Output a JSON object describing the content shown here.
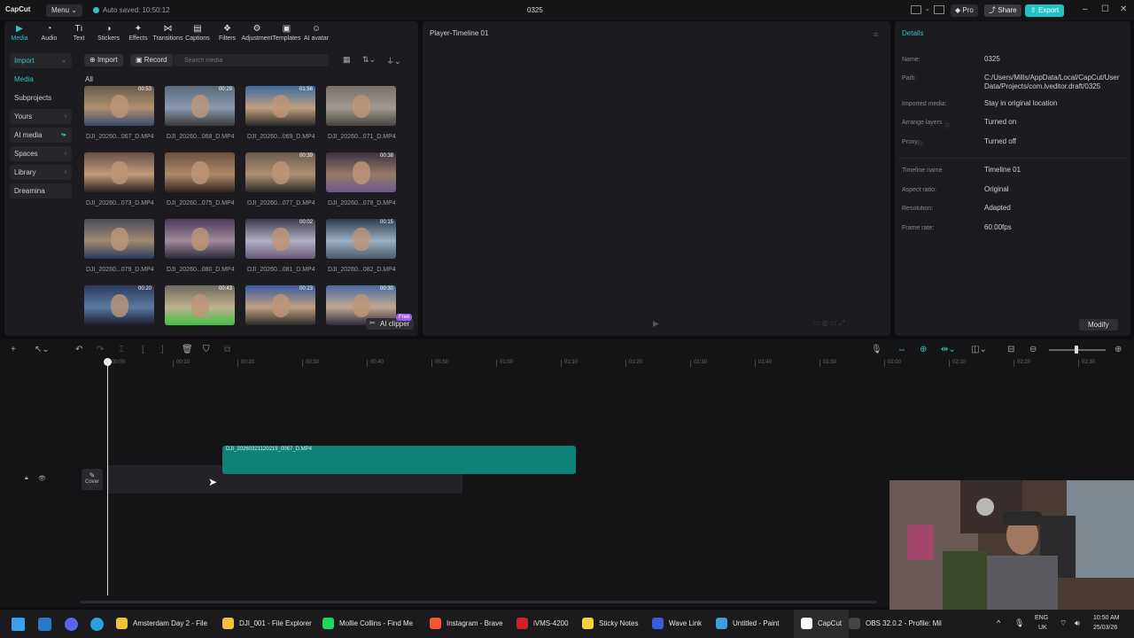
{
  "titlebar": {
    "logo": "CapCut",
    "menu_label": "Menu",
    "autosave": "Auto saved: 10:50:12",
    "project_name": "0325",
    "pro_label": "Pro",
    "share_label": "Share",
    "export_label": "Export"
  },
  "toolbar": {
    "tabs": [
      {
        "label": "Media",
        "icon": "media-icon"
      },
      {
        "label": "Audio",
        "icon": "audio-icon"
      },
      {
        "label": "Text",
        "icon": "text-icon"
      },
      {
        "label": "Stickers",
        "icon": "stickers-icon"
      },
      {
        "label": "Effects",
        "icon": "effects-icon"
      },
      {
        "label": "Transitions",
        "icon": "transitions-icon"
      },
      {
        "label": "Captions",
        "icon": "captions-icon"
      },
      {
        "label": "Filters",
        "icon": "filters-icon"
      },
      {
        "label": "Adjustment",
        "icon": "adjustment-icon"
      },
      {
        "label": "Templates",
        "icon": "templates-icon"
      },
      {
        "label": "AI avatar",
        "icon": "ai-avatar-icon"
      }
    ]
  },
  "sidebar": {
    "items": [
      {
        "label": "Import"
      },
      {
        "label": "Media"
      },
      {
        "label": "Subprojects"
      },
      {
        "label": "Yours"
      },
      {
        "label": "AI media"
      },
      {
        "label": "Spaces"
      },
      {
        "label": "Library"
      },
      {
        "label": "Dreamina"
      }
    ]
  },
  "media": {
    "import_label": "Import",
    "record_label": "Record",
    "search_placeholder": "Search media",
    "all_label": "All",
    "ai_clipper_label": "AI clipper",
    "free_badge": "Free",
    "items": [
      {
        "name": "DJI_20260...067_D.MP4",
        "duration": "00:53"
      },
      {
        "name": "DJI_20260...068_D.MP4",
        "duration": "00:29"
      },
      {
        "name": "DJI_20260...069_D.MP4",
        "duration": "01:56"
      },
      {
        "name": "DJI_20260...071_D.MP4",
        "duration": ""
      },
      {
        "name": "DJI_20260...073_D.MP4",
        "duration": ""
      },
      {
        "name": "DJI_20260...075_D.MP4",
        "duration": ""
      },
      {
        "name": "DJI_20260...077_D.MP4",
        "duration": "00:39"
      },
      {
        "name": "DJI_20260...078_D.MP4",
        "duration": "00:38"
      },
      {
        "name": "DJI_20260...079_D.MP4",
        "duration": ""
      },
      {
        "name": "DJI_20260...080_D.MP4",
        "duration": ""
      },
      {
        "name": "DJI_20260...081_D.MP4",
        "duration": "00:02"
      },
      {
        "name": "DJI_20260...082_D.MP4",
        "duration": "00:15"
      },
      {
        "name": "",
        "duration": "00:20"
      },
      {
        "name": "",
        "duration": "00:43"
      },
      {
        "name": "",
        "duration": "00:23"
      },
      {
        "name": "",
        "duration": "00:30"
      }
    ]
  },
  "player": {
    "title": "Player-Timeline 01"
  },
  "details": {
    "title": "Details",
    "rows": [
      {
        "label": "Name:",
        "value": "0325"
      },
      {
        "label": "Path:",
        "value": "C:/Users/Mills/AppData/Local/CapCut/User Data/Projects/com.lveditor.draft/0325"
      },
      {
        "label": "Imported media:",
        "value": "Stay in original location"
      },
      {
        "label": "Arrange layers",
        "value": "Turned on"
      },
      {
        "label": "Proxy:",
        "value": "Turned off"
      },
      {
        "label": "Timeline name",
        "value": "Timeline 01"
      },
      {
        "label": "Aspect ratio:",
        "value": "Original"
      },
      {
        "label": "Resolution:",
        "value": "Adapted"
      },
      {
        "label": "Frame rate:",
        "value": "60.00fps"
      }
    ],
    "modify_label": "Modify"
  },
  "timeline": {
    "ticks": [
      "00:00",
      "00:10",
      "00:20",
      "00:30",
      "00:40",
      "00:50",
      "01:00",
      "01:10",
      "01:20",
      "01:30",
      "01:40",
      "01:50",
      "02:00",
      "02:10",
      "02:20",
      "02:30"
    ],
    "clip_label": "DJI_20260321120219_0067_D.MP4",
    "cover_label": "Cover"
  },
  "taskbar": {
    "items": [
      {
        "label": "Amsterdam Day 2 - File",
        "color": "#f0c23b"
      },
      {
        "label": "DJI_001 - File Explorer",
        "color": "#f0c23b"
      },
      {
        "label": "Mollie Collins - Find Me",
        "color": "#1ed760"
      },
      {
        "label": "Instagram - Brave",
        "color": "#fb542b"
      },
      {
        "label": "iVMS-4200",
        "color": "#d0202a"
      },
      {
        "label": "Sticky Notes",
        "color": "#f5d13a"
      },
      {
        "label": "Wave Link",
        "color": "#3b5bdb"
      },
      {
        "label": "Untitled - Paint",
        "color": "#3ba0d9"
      },
      {
        "label": "CapCut",
        "color": "#ffffff"
      },
      {
        "label": "OBS 32.0.2 - Profile: Mil",
        "color": "#444444"
      }
    ],
    "lang_top": "ENG",
    "lang_bottom": "UK",
    "time": "10:50 AM",
    "date": "25/03/26"
  },
  "colors": {
    "accent": "#2ec3c3",
    "clip": "#0f8277"
  }
}
